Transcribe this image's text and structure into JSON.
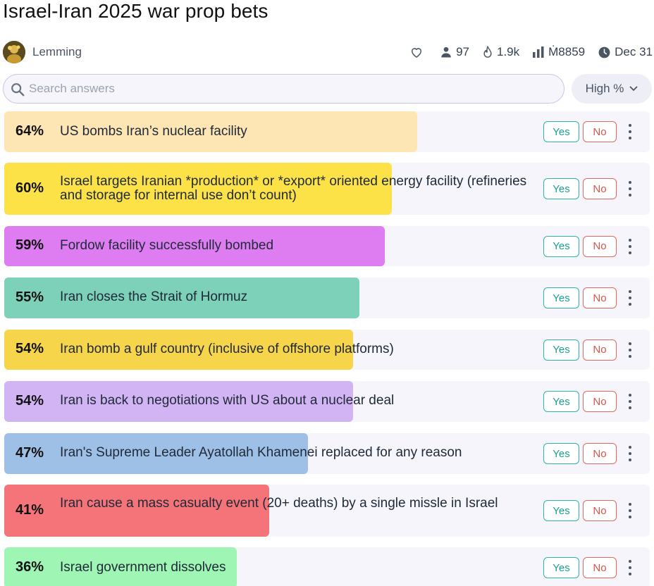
{
  "title": "Israel-Iran 2025 war prop bets",
  "author": "Lemming",
  "stats": {
    "traders": "97",
    "views": "1.9k",
    "volume": "Ṁ8859",
    "close_date": "Dec 31"
  },
  "search": {
    "placeholder": "Search answers"
  },
  "sort": {
    "label": "High %"
  },
  "buttons": {
    "yes": "Yes",
    "no": "No"
  },
  "answers": [
    {
      "pct": "64%",
      "probability": 0.64,
      "text": "US bombs Iran’s nuclear facility",
      "color": "#fde5b4"
    },
    {
      "pct": "60%",
      "probability": 0.6,
      "text": "Israel targets Iranian *production* or *export* oriented energy facility (refineries and storage for internal use don’t count)",
      "color": "#fce246"
    },
    {
      "pct": "59%",
      "probability": 0.59,
      "text": "Fordow facility successfully bombed",
      "color": "#de7df2"
    },
    {
      "pct": "55%",
      "probability": 0.55,
      "text": "Iran closes the Strait of Hormuz",
      "color": "#7cd1b8"
    },
    {
      "pct": "54%",
      "probability": 0.54,
      "text": "Iran bomb a gulf country (inclusive of offshore platforms)",
      "color": "#f7d54a"
    },
    {
      "pct": "54%",
      "probability": 0.54,
      "text": "Iran is back to negotiations with US about a nuclear deal",
      "color": "#d2b4f4"
    },
    {
      "pct": "47%",
      "probability": 0.47,
      "text": "Iran's Supreme Leader Ayatollah Khamenei replaced for any reason",
      "color": "#9ec0e6"
    },
    {
      "pct": "41%",
      "probability": 0.41,
      "text": "Iran cause a mass casualty event (20+ deaths) by a single missle in Israel",
      "color": "#f47479"
    },
    {
      "pct": "36%",
      "probability": 0.36,
      "text": "Israel government dissolves",
      "color": "#9ef5b4"
    }
  ]
}
